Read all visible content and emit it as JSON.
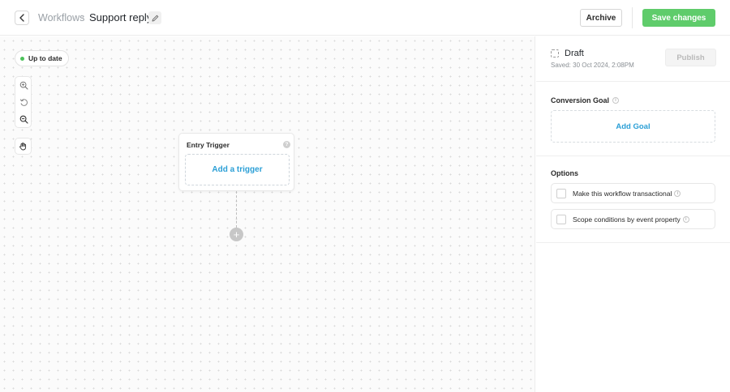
{
  "header": {
    "breadcrumb_root": "Workflows",
    "breadcrumb_separator": "›",
    "workflow_name": "Support reply",
    "archive_label": "Archive",
    "save_label": "Save changes"
  },
  "canvas": {
    "status_label": "Up to date",
    "trigger_card": {
      "title": "Entry Trigger",
      "help": "?",
      "add_label": "Add a trigger"
    },
    "add_step": "+",
    "icons": [
      "zoom-in-icon",
      "reset-icon",
      "zoom-out-icon",
      "hand-icon"
    ]
  },
  "panel": {
    "status": "Draft",
    "saved_text": "Saved: 30 Oct 2024, 2:08PM",
    "publish_label": "Publish",
    "conversion_goal": {
      "label": "Conversion Goal",
      "add_label": "Add Goal"
    },
    "options": {
      "label": "Options",
      "items": [
        {
          "label": "Make this workflow transactional"
        },
        {
          "label": "Scope conditions by event property"
        }
      ]
    },
    "info_glyph": "i"
  },
  "colors": {
    "primary_green": "#5fcc6b",
    "link_blue": "#2b9fd6",
    "status_green": "#4cc25a"
  }
}
